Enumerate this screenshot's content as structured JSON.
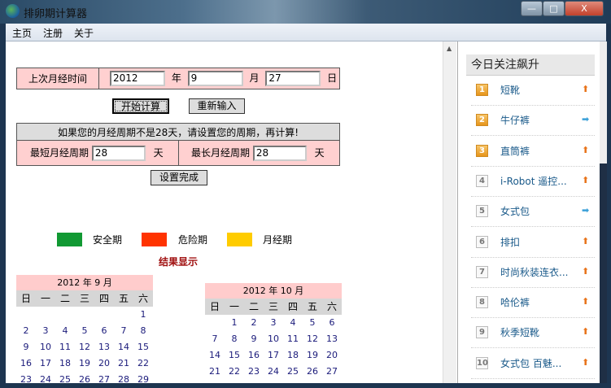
{
  "window": {
    "title": "排卵期计算器",
    "minimize": "—",
    "maximize": "□",
    "close": "X"
  },
  "menu": [
    "主页",
    "注册",
    "关于"
  ],
  "form": {
    "last_period_label": "上次月经时间",
    "year": "2012",
    "year_unit": "年",
    "month": "9",
    "month_unit": "月",
    "day": "27",
    "day_unit": "日",
    "start_button": "开始计算",
    "reset_button": "重新输入",
    "cycle_notice": "如果您的月经周期不是28天，请设置您的周期，再计算!",
    "min_cycle_label": "最短月经周期",
    "min_cycle": "28",
    "max_cycle_label": "最长月经周期",
    "max_cycle": "28",
    "day_suffix": "天",
    "done_button": "设置完成"
  },
  "legend": [
    {
      "label": "安全期",
      "color": "#119933"
    },
    {
      "label": "危险期",
      "color": "#ff3300"
    },
    {
      "label": "月经期",
      "color": "#ffcc00"
    }
  ],
  "result_title": "结果显示",
  "weekdays": [
    "日",
    "一",
    "二",
    "三",
    "四",
    "五",
    "六"
  ],
  "calendars": [
    {
      "title": "2012 年 9 月",
      "weeks": [
        [
          "",
          "",
          "",
          "",
          "",
          "",
          "1"
        ],
        [
          "2",
          "3",
          "4",
          "5",
          "6",
          "7",
          "8"
        ],
        [
          "9",
          "10",
          "11",
          "12",
          "13",
          "14",
          "15"
        ],
        [
          "16",
          "17",
          "18",
          "19",
          "20",
          "21",
          "22"
        ],
        [
          "23",
          "24",
          "25",
          "26",
          "27",
          "28",
          "29"
        ]
      ]
    },
    {
      "title": "2012 年 10 月",
      "weeks": [
        [
          "",
          "1",
          "2",
          "3",
          "4",
          "5",
          "6"
        ],
        [
          "7",
          "8",
          "9",
          "10",
          "11",
          "12",
          "13"
        ],
        [
          "14",
          "15",
          "16",
          "17",
          "18",
          "19",
          "20"
        ],
        [
          "21",
          "22",
          "23",
          "24",
          "25",
          "26",
          "27"
        ]
      ]
    }
  ],
  "panel": {
    "title": "今日关注飙升",
    "items": [
      {
        "rank": "1",
        "name": "短靴",
        "trend": "up"
      },
      {
        "rank": "2",
        "name": "牛仔裤",
        "trend": "flat"
      },
      {
        "rank": "3",
        "name": "直筒裤",
        "trend": "up"
      },
      {
        "rank": "4",
        "name": "i-Robot 遥控...",
        "trend": "up"
      },
      {
        "rank": "5",
        "name": "女式包",
        "trend": "flat"
      },
      {
        "rank": "6",
        "name": "排扣",
        "trend": "up"
      },
      {
        "rank": "7",
        "name": "时尚秋装连衣...",
        "trend": "up"
      },
      {
        "rank": "8",
        "name": "哈伦裤",
        "trend": "up"
      },
      {
        "rank": "9",
        "name": "秋季短靴",
        "trend": "up"
      },
      {
        "rank": "10",
        "name": "女式包 百魅...",
        "trend": "up"
      }
    ]
  }
}
